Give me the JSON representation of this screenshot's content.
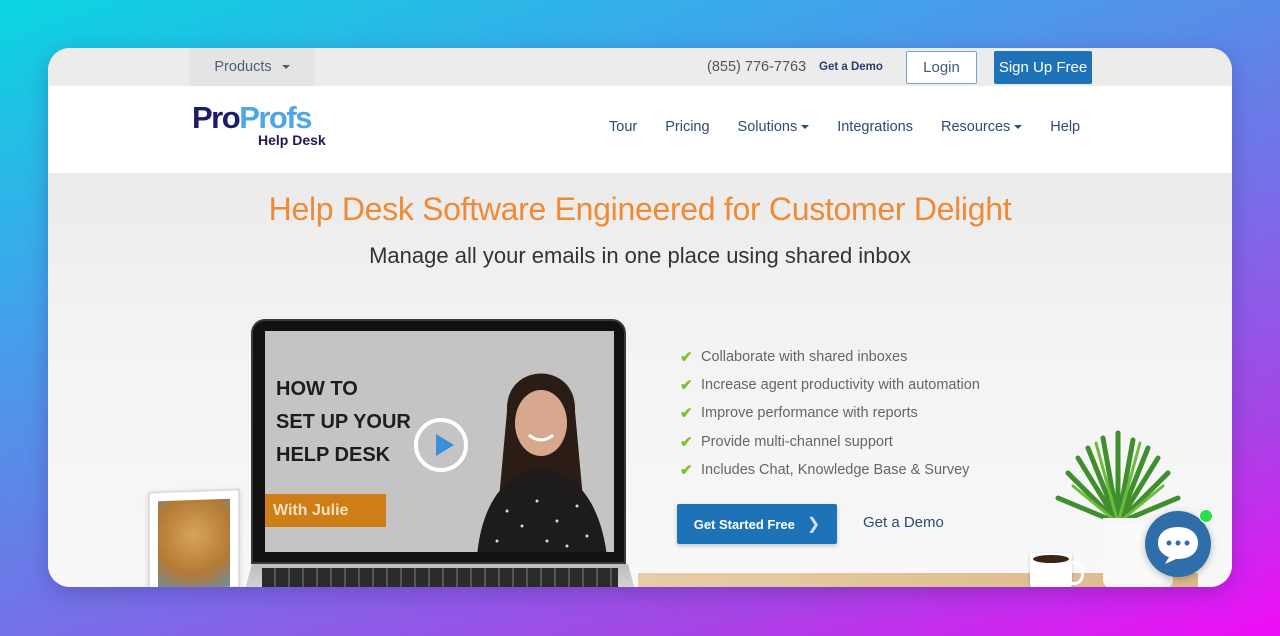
{
  "topbar": {
    "products_label": "Products",
    "phone": "(855) 776-7763",
    "get_demo_label": "Get a Demo",
    "login_label": "Login",
    "signup_label": "Sign Up Free"
  },
  "logo": {
    "pro": "Pro",
    "profs": "Profs",
    "subtitle": "Help Desk"
  },
  "nav": {
    "items": [
      {
        "label": "Tour",
        "dropdown": false
      },
      {
        "label": "Pricing",
        "dropdown": false
      },
      {
        "label": "Solutions",
        "dropdown": true
      },
      {
        "label": "Integrations",
        "dropdown": false
      },
      {
        "label": "Resources",
        "dropdown": true
      },
      {
        "label": "Help",
        "dropdown": false
      }
    ]
  },
  "hero": {
    "headline": "Help Desk Software Engineered for Customer Delight",
    "subheadline": "Manage all your emails in one place using shared inbox",
    "video": {
      "title_lines": [
        "HOW TO",
        "SET UP YOUR",
        "HELP DESK"
      ],
      "presenter_tag": "With Julie",
      "play_icon": "play-icon"
    },
    "features": [
      "Collaborate with shared inboxes",
      "Increase agent productivity with automation",
      "Improve performance with reports",
      "Provide multi-channel support",
      "Includes Chat, Knowledge Base & Survey"
    ],
    "cta_primary": "Get Started Free",
    "cta_secondary": "Get a Demo"
  },
  "chat_widget": {
    "icon": "chat-bubble-icon",
    "status": "online"
  },
  "colors": {
    "accent_orange": "#f08a35",
    "brand_blue": "#1e73b8",
    "nav_text": "#2d4b73",
    "check_green": "#7cc22a",
    "online_green": "#28e04a"
  }
}
